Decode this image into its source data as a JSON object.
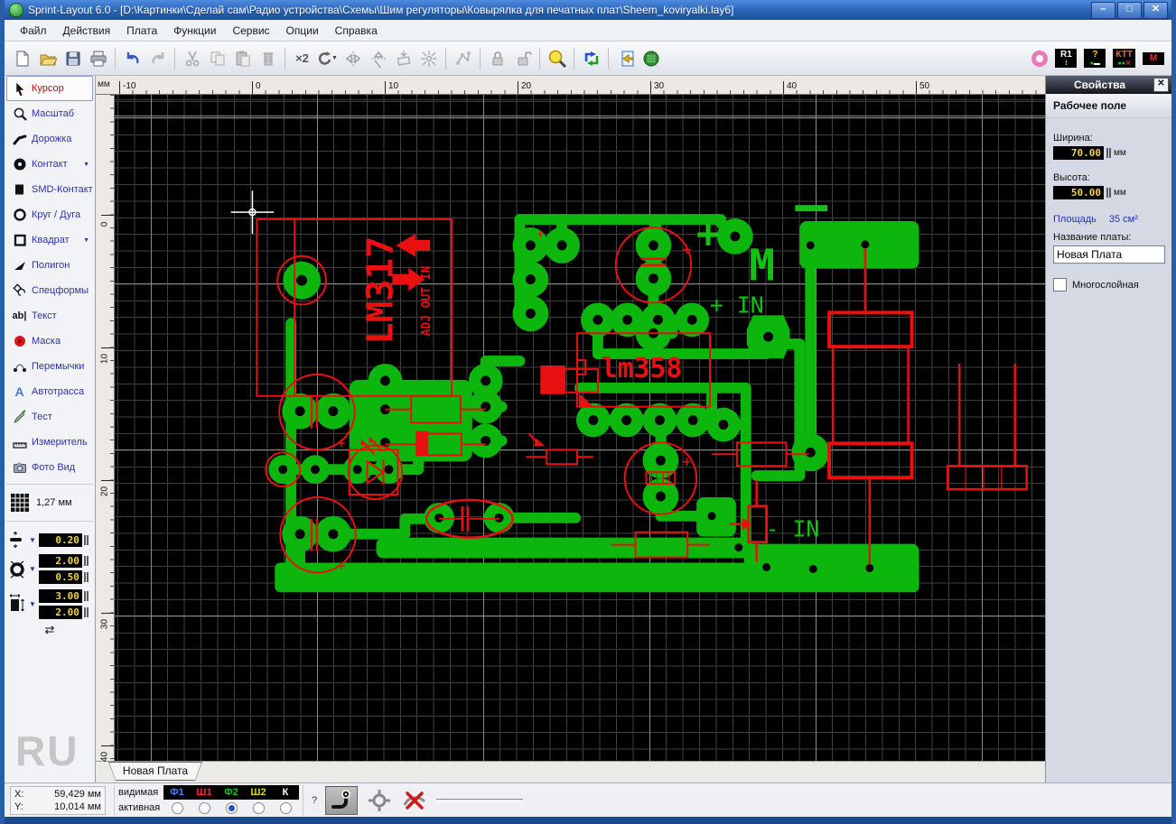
{
  "window": {
    "title": "Sprint-Layout 6.0 - [D:\\Картинки\\Сделай сам\\Радио устройства\\Схемы\\Шим регуляторы\\Ковырялка для печатных плат\\Sheem_koviryalki.lay6]",
    "minimize": "–",
    "maximize": "□",
    "close": "✕"
  },
  "menu": {
    "items": [
      "Файл",
      "Действия",
      "Плата",
      "Функции",
      "Сервис",
      "Опции",
      "Справка"
    ]
  },
  "toolbar": {
    "x2": "×2",
    "rotate": "C",
    "chips": {
      "r1": "R1",
      "help": "?",
      "ktt": "КТТ",
      "m": "M"
    }
  },
  "tools": {
    "items": [
      {
        "label": "Курсор"
      },
      {
        "label": "Масштаб"
      },
      {
        "label": "Дорожка"
      },
      {
        "label": "Контакт"
      },
      {
        "label": "SMD-Контакт"
      },
      {
        "label": "Круг / Дуга"
      },
      {
        "label": "Квадрат"
      },
      {
        "label": "Полигон"
      },
      {
        "label": "Спецформы"
      },
      {
        "label": "Текст"
      },
      {
        "label": "Маска"
      },
      {
        "label": "Перемычки"
      },
      {
        "label": "Автотрасса"
      },
      {
        "label": "Тест"
      },
      {
        "label": "Измеритель"
      },
      {
        "label": "Фото Вид"
      }
    ],
    "grid_value": "1,27 мм",
    "track_width": "0.20",
    "pad_outer": "2.00",
    "pad_drill": "0.50",
    "smd_width": "3.00",
    "smd_height": "2.00"
  },
  "watermark": "RU",
  "ruler": {
    "unit": "мм",
    "h_labels": [
      "-10",
      "0",
      "10",
      "20",
      "30",
      "40",
      "50"
    ],
    "v_labels": [
      "0",
      "10",
      "20",
      "30",
      "40"
    ]
  },
  "pcb": {
    "labels": {
      "ic1": "LM317",
      "ic1_pins": "ADJ OUT IN",
      "ic2": "lm358",
      "plus_in": "+ IN",
      "minus_in": "- IN",
      "motor": "M",
      "plus": "+"
    },
    "colors": {
      "copper": "#0cb60c",
      "silk": "#e81010",
      "background": "#000000",
      "grid_minor": "#3f3f3f",
      "grid_major": "#8a8a8a"
    }
  },
  "tab": {
    "label": "Новая Плата"
  },
  "properties": {
    "title": "Свойства",
    "close": "✕",
    "section": "Рабочее поле",
    "width_label": "Ширина:",
    "width_value": "70.00",
    "height_label": "Высота:",
    "height_value": "50.00",
    "unit": "мм",
    "area_label": "Площадь",
    "area_value": "35 см²",
    "name_label": "Название платы:",
    "board_name": "Новая Плата",
    "multilayer": "Многослойная"
  },
  "statusbar": {
    "x_label": "X:",
    "x_value": "59,429 мм",
    "y_label": "Y:",
    "y_value": "10,014 мм",
    "visible_label": "видимая",
    "active_label": "активная",
    "help": "?",
    "layers": [
      {
        "name": "Ф1",
        "color": "#4f7dff"
      },
      {
        "name": "Ш1",
        "color": "#ff2a2a"
      },
      {
        "name": "Ф2",
        "color": "#17c417"
      },
      {
        "name": "Ш2",
        "color": "#d8d820"
      },
      {
        "name": "К",
        "color": "#ffffff"
      }
    ],
    "active_index": 2
  }
}
